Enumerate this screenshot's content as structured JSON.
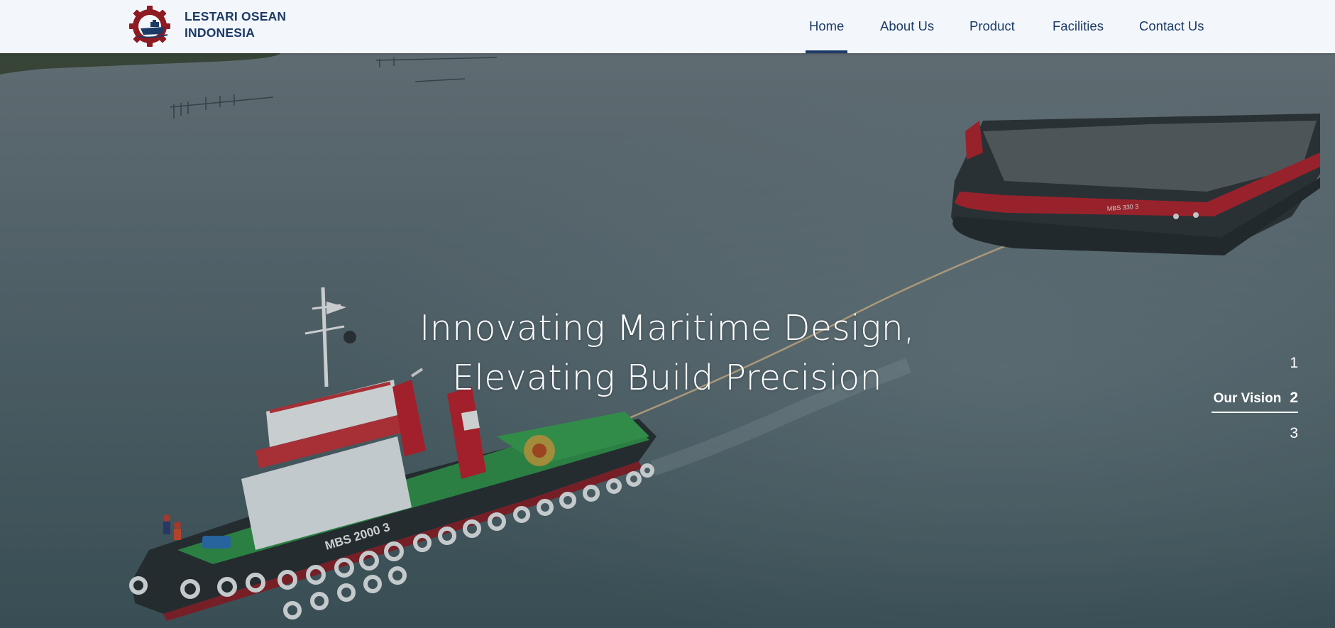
{
  "brand": {
    "name_line1": "LESTARI OSEAN",
    "name_line2": "INDONESIA",
    "logo_icon": "gear-ship-logo"
  },
  "nav": {
    "items": [
      {
        "label": "Home",
        "active": true
      },
      {
        "label": "About Us",
        "active": false
      },
      {
        "label": "Product",
        "active": false
      },
      {
        "label": "Facilities",
        "active": false
      },
      {
        "label": "Contact Us",
        "active": false
      }
    ]
  },
  "hero": {
    "title_line1": "Innovating Maritime Design,",
    "title_line2": "Elevating Build Precision",
    "boats": {
      "tug_name": "MBS 2000 3",
      "barge_name": "MBS 330 3"
    }
  },
  "slider": {
    "items": [
      {
        "number": "1",
        "label": "",
        "active": false
      },
      {
        "number": "2",
        "label": "Our Vision",
        "active": true
      },
      {
        "number": "3",
        "label": "",
        "active": false
      }
    ]
  },
  "colors": {
    "header_bg": "#f3f7fc",
    "brand_text": "#1c3a66",
    "accent_red": "#b4202a",
    "water": "#54666f"
  }
}
